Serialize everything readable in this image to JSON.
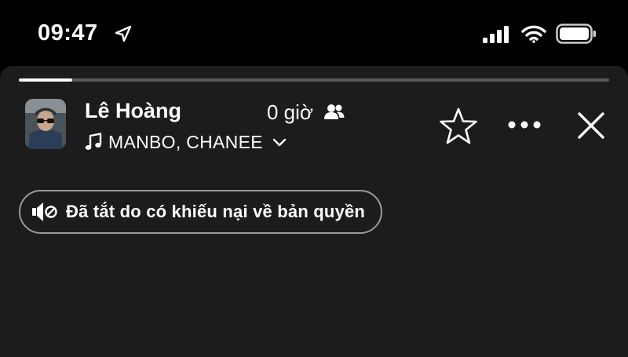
{
  "status_bar": {
    "time": "09:47",
    "icons": [
      "location-arrow-icon",
      "signal-icon",
      "wifi-icon",
      "battery-icon"
    ]
  },
  "story": {
    "progress": 0.09,
    "author_name": "Lê Hoàng",
    "time_ago": "0 giờ",
    "audience_icon": "friends-icon",
    "music": {
      "icon": "music-note-icon",
      "song": "MANBO, CHANEE"
    },
    "actions": [
      "star-icon",
      "more-icon",
      "close-icon"
    ]
  },
  "notice": {
    "icon": "muted-speaker-icon",
    "text": "Đã tắt do có khiếu nại về bản quyền"
  },
  "colors": {
    "background": "#000000",
    "sheet": "#1c1c1c",
    "text": "#ffffff",
    "progress_track": "#5a5a5a",
    "pill_border": "#9a9a9a"
  }
}
